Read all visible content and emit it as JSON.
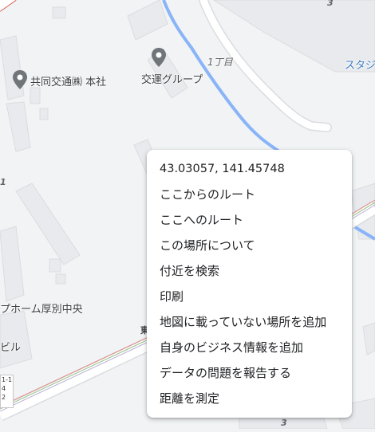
{
  "map": {
    "pois": [
      {
        "label": "共同交通㈱ 本社"
      },
      {
        "label": "交運グループ"
      }
    ],
    "area_labels": {
      "chome_1": "1丁目",
      "station_partial": "スタジ",
      "home_partial": "プホーム厚別中央",
      "building_partial": "ビル",
      "block_num_top": "3",
      "block_num_bottom": "3",
      "block_num_left": "1",
      "road_partial": "東"
    },
    "scale_lines": [
      "1-1",
      "4",
      "2"
    ],
    "colors": {
      "land": "#f1f3f4",
      "building": "#e8eaed",
      "building_stroke": "#dadce0",
      "river": "#8ab4f8",
      "road": "#ffffff",
      "pin": "#70757a"
    }
  },
  "context_menu": {
    "coordinates": "43.03057, 141.45748",
    "items": [
      {
        "name": "route-from-here",
        "label": "ここからのルート"
      },
      {
        "name": "route-to-here",
        "label": "ここへのルート"
      },
      {
        "name": "about-this-place",
        "label": "この場所について"
      },
      {
        "name": "search-nearby",
        "label": "付近を検索"
      },
      {
        "name": "print",
        "label": "印刷"
      },
      {
        "name": "add-missing-place",
        "label": "地図に載っていない場所を追加"
      },
      {
        "name": "add-business",
        "label": "自身のビジネス情報を追加"
      },
      {
        "name": "report-data-problem",
        "label": "データの問題を報告する"
      },
      {
        "name": "measure-distance",
        "label": "距離を測定"
      }
    ]
  }
}
